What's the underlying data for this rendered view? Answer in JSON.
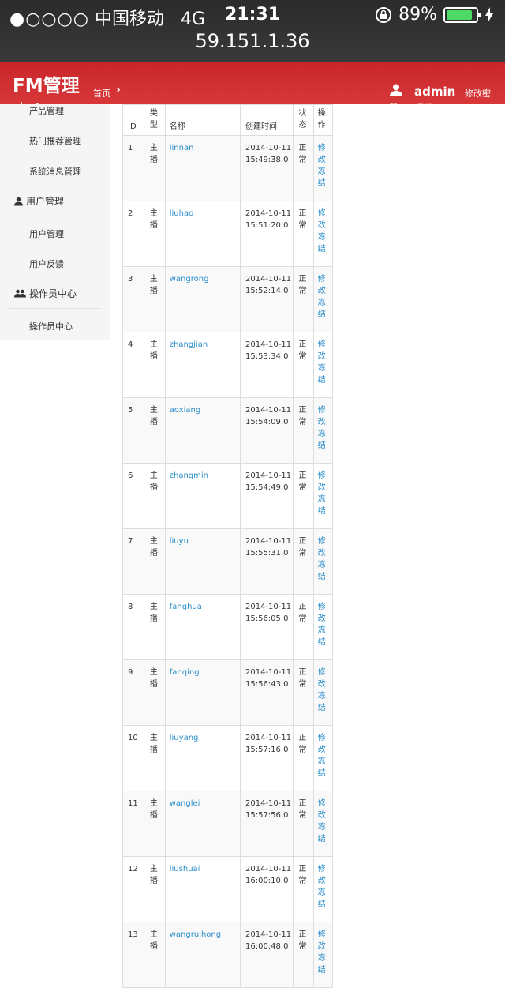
{
  "status_bar": {
    "signal_dots": "●○○○○",
    "carrier": "中国移动",
    "network": "4G",
    "time": "21:31",
    "battery_percent": "89%",
    "battery_level": 0.89,
    "url": "59.151.1.36"
  },
  "header": {
    "brand": "FM管理",
    "brand_overflow": "中心",
    "breadcrumb_home": "首页",
    "username": "admin",
    "change_password": "修改密",
    "user_sub": "码",
    "logout": "退出"
  },
  "sidebar": {
    "items": [
      {
        "label": "产品管理"
      },
      {
        "label": "热门推荐管理"
      },
      {
        "label": "系统消息管理"
      }
    ],
    "groups": [
      {
        "label": "用户管理",
        "icon": "user-icon",
        "children": [
          "用户管理",
          "用户反馈"
        ]
      },
      {
        "label": "操作员中心",
        "icon": "users-icon",
        "children": [
          "操作员中心"
        ]
      }
    ]
  },
  "table": {
    "headers": [
      "ID",
      "类型",
      "名称",
      "创建时间",
      "状态",
      "操作"
    ],
    "action_labels": [
      "修改",
      "冻结"
    ],
    "rows": [
      {
        "id": "1",
        "type": "主播",
        "name": "linnan",
        "date": "2014-10-11",
        "time": "15:49:38.0",
        "state": "正常"
      },
      {
        "id": "2",
        "type": "主播",
        "name": "liuhao",
        "date": "2014-10-11",
        "time": "15:51:20.0",
        "state": "正常"
      },
      {
        "id": "3",
        "type": "主播",
        "name": "wangrong",
        "date": "2014-10-11",
        "time": "15:52:14.0",
        "state": "正常"
      },
      {
        "id": "4",
        "type": "主播",
        "name": "zhangjian",
        "date": "2014-10-11",
        "time": "15:53:34.0",
        "state": "正常"
      },
      {
        "id": "5",
        "type": "主播",
        "name": "aoxiang",
        "date": "2014-10-11",
        "time": "15:54:09.0",
        "state": "正常"
      },
      {
        "id": "6",
        "type": "主播",
        "name": "zhangmin",
        "date": "2014-10-11",
        "time": "15:54:49.0",
        "state": "正常"
      },
      {
        "id": "7",
        "type": "主播",
        "name": "liuyu",
        "date": "2014-10-11",
        "time": "15:55:31.0",
        "state": "正常"
      },
      {
        "id": "8",
        "type": "主播",
        "name": "fanghua",
        "date": "2014-10-11",
        "time": "15:56:05.0",
        "state": "正常"
      },
      {
        "id": "9",
        "type": "主播",
        "name": "fanqing",
        "date": "2014-10-11",
        "time": "15:56:43.0",
        "state": "正常"
      },
      {
        "id": "10",
        "type": "主播",
        "name": "liuyang",
        "date": "2014-10-11",
        "time": "15:57:16.0",
        "state": "正常"
      },
      {
        "id": "11",
        "type": "主播",
        "name": "wanglei",
        "date": "2014-10-11",
        "time": "15:57:56.0",
        "state": "正常"
      },
      {
        "id": "12",
        "type": "主播",
        "name": "liushuai",
        "date": "2014-10-11",
        "time": "16:00:10.0",
        "state": "正常"
      },
      {
        "id": "13",
        "type": "主播",
        "name": "wangruihong",
        "date": "2014-10-11",
        "time": "16:00:48.0",
        "state": "正常"
      }
    ]
  }
}
